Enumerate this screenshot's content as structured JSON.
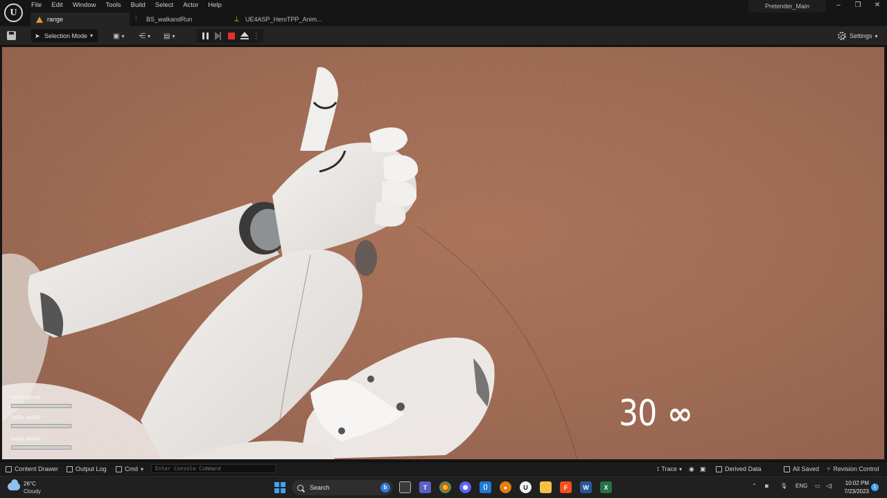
{
  "menu": [
    "File",
    "Edit",
    "Window",
    "Tools",
    "Build",
    "Select",
    "Actor",
    "Help"
  ],
  "tabs": [
    {
      "label": "range",
      "icon": "warning-icon"
    },
    {
      "label": "BS_walkandRun",
      "icon": "blendspace-icon"
    },
    {
      "label": "UE4ASP_HeroTPP_Anim...",
      "icon": "anim-blueprint-icon"
    }
  ],
  "project_name": "Pretender_Main",
  "window_controls": {
    "minimize": "–",
    "restore": "❐",
    "close": "✕"
  },
  "toolbar": {
    "selection_mode": "Selection Mode",
    "settings": "Settings"
  },
  "viewport": {
    "hud_messages": [
      "hello world",
      "hello world",
      "hello world"
    ],
    "fps_value": "30",
    "fps_symbol": "∞"
  },
  "statusbar": {
    "content_drawer": "Content Drawer",
    "output_log": "Output Log",
    "cmd": "Cmd",
    "console_placeholder": "Enter Console Command",
    "trace": "Trace",
    "derived_data": "Derived Data",
    "all_saved": "All Saved",
    "revision_control": "Revision Control"
  },
  "taskbar": {
    "weather_temp": "26°C",
    "weather_desc": "Cloudy",
    "search_placeholder": "Search",
    "tray_lang": "ENG",
    "clock_time": "10:02 PM",
    "clock_date": "7/23/2023"
  },
  "colors": {
    "viewport_ground": "#935a42",
    "stop_button": "#e0322a",
    "windows_accent": "#3fa3f5",
    "tab_warning": "#e29a2a"
  }
}
